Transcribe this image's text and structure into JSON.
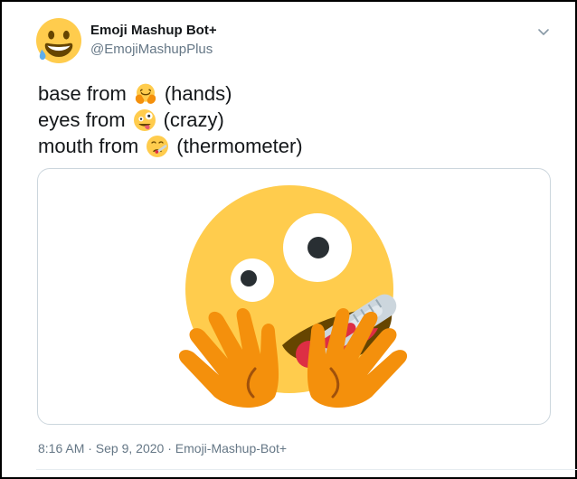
{
  "tweet": {
    "display_name": "Emoji Mashup Bot+",
    "handle": "@EmojiMashupPlus",
    "lines": [
      {
        "prefix": "base from",
        "emoji_icon": "hugging-face-icon",
        "suffix": "(hands)"
      },
      {
        "prefix": "eyes from",
        "emoji_icon": "zany-face-icon",
        "suffix": "(crazy)"
      },
      {
        "prefix": "mouth from",
        "emoji_icon": "face-with-thermometer-icon",
        "suffix": "(thermometer)"
      }
    ],
    "timestamp": "8:16 AM · Sep 9, 2020",
    "separator": " · ",
    "source": "Emoji-Mashup-Bot+"
  },
  "icons": {
    "avatar": "grinning-face-with-sweat-icon",
    "menu": "chevron-down-icon",
    "media": "emoji-mashup-image"
  },
  "colors": {
    "emoji_yellow": "#FFCC4D",
    "hand_orange": "#F4900C",
    "text_primary": "#14171a",
    "text_secondary": "#657786",
    "border": "#ccd6dd"
  }
}
